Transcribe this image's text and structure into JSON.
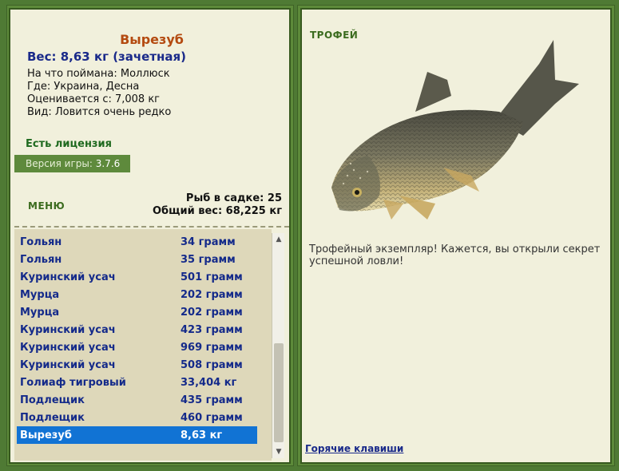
{
  "fish": {
    "name": "Вырезуб",
    "weight": "Вес: 8,63 кг (зачетная)",
    "bait": "На что поймана: Моллюск",
    "where": "Где: Украина, Десна",
    "value": "Оценивается с: 7,008 кг",
    "kind": "Вид: Ловится очень редко"
  },
  "license": "Есть лицензия",
  "version": {
    "label": "Версия игры:",
    "value": "3.7.6"
  },
  "menu_label": "МЕНЮ",
  "cage": {
    "count": "Рыб в садке: 25",
    "total": "Общий вес: 68,225 кг"
  },
  "list": [
    {
      "name": "Гольян",
      "weight": "34 грамм"
    },
    {
      "name": "Гольян",
      "weight": "35 грамм"
    },
    {
      "name": "Куринский усач",
      "weight": "501 грамм"
    },
    {
      "name": "Мурца",
      "weight": "202 грамм"
    },
    {
      "name": "Мурца",
      "weight": "202 грамм"
    },
    {
      "name": "Куринский усач",
      "weight": "423 грамм"
    },
    {
      "name": "Куринский усач",
      "weight": "969 грамм"
    },
    {
      "name": "Куринский усач",
      "weight": "508 грамм"
    },
    {
      "name": "Голиаф тигровый",
      "weight": "33,404 кг"
    },
    {
      "name": "Подлещик",
      "weight": "435 грамм"
    },
    {
      "name": "Подлещик",
      "weight": "460 грамм"
    },
    {
      "name": "Вырезуб",
      "weight": "8,63 кг"
    }
  ],
  "selected_index": 11,
  "trophy": {
    "label": "ТРОФЕЙ",
    "text": "Трофейный экземпляр! Кажется, вы открыли секрет успешной ловли!"
  },
  "hotkeys": "Горячие клавиши",
  "colors": {
    "accent_green": "#5d8a3a",
    "panel_bg": "#f1f0dc",
    "selection": "#1173d4",
    "title_orange": "#b44a10",
    "text_blue": "#142a8a"
  }
}
